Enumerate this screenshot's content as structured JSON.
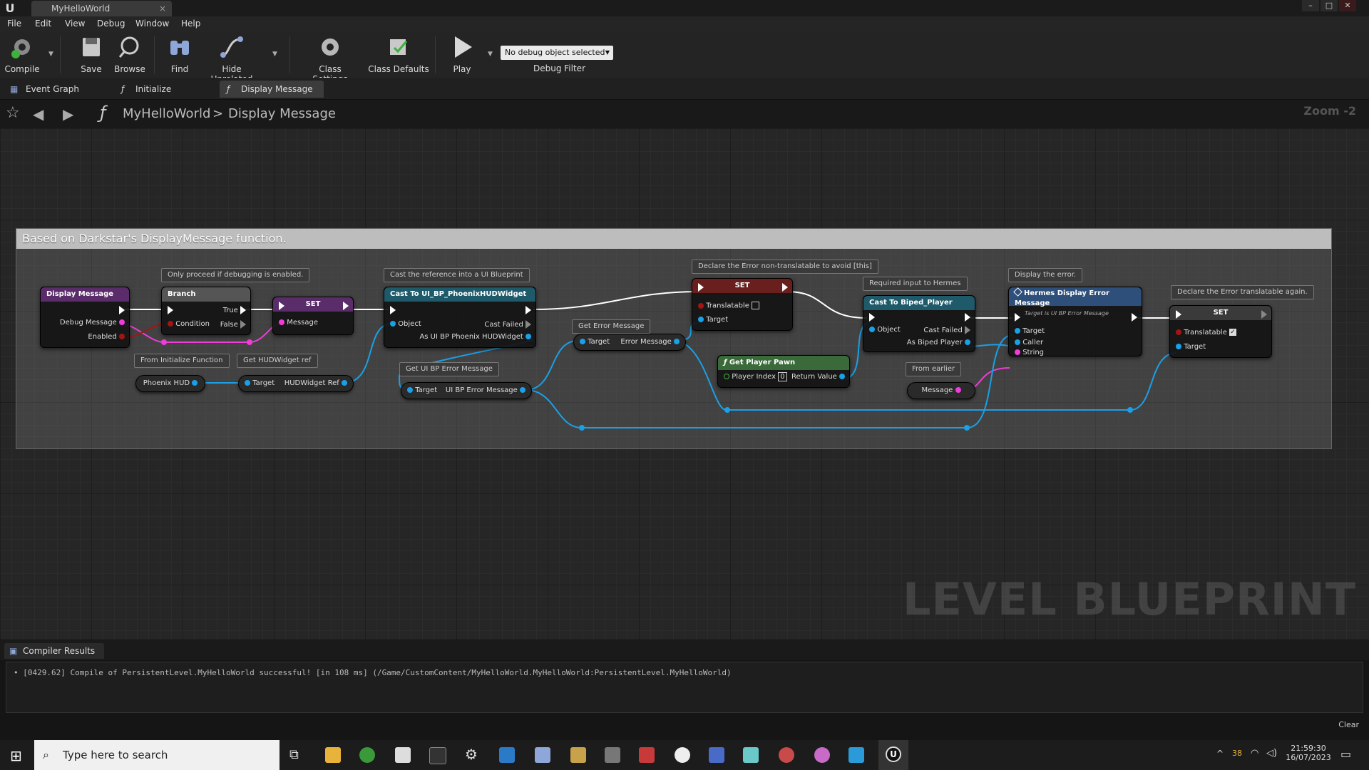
{
  "window": {
    "tab_title": "MyHelloWorld",
    "tab_close": "×"
  },
  "menu": [
    "File",
    "Edit",
    "View",
    "Debug",
    "Window",
    "Help"
  ],
  "toolbar": {
    "compile": "Compile",
    "save": "Save",
    "browse": "Browse",
    "find": "Find",
    "hide_unrelated": "Hide Unrelated",
    "class_settings": "Class Settings",
    "class_defaults": "Class Defaults",
    "play": "Play",
    "debug_select": "No debug object selected",
    "debug_filter": "Debug Filter"
  },
  "doc_tabs": [
    "Event Graph",
    "Initialize",
    "Display Message"
  ],
  "breadcrumb": {
    "root": "MyHelloWorld",
    "sep": ">",
    "current": "Display Message",
    "zoom": "Zoom -2"
  },
  "comment_title": "Based on Darkstar's DisplayMessage function.",
  "bubbles": {
    "b1": "Only proceed if debugging is enabled.",
    "b2": "Cast the reference into a UI Blueprint",
    "b3": "Declare the Error non-translatable to avoid [this]",
    "b4": "Required input to Hermes",
    "b5": "Display the error.",
    "b6": "Declare the Error translatable again.",
    "b7": "From Initialize Function",
    "b8": "Get HUDWidget ref",
    "b9": "Get Error Message",
    "b10": "Get UI BP Error Message",
    "b11": "From earlier"
  },
  "nodes": {
    "display_message": {
      "title": "Display Message",
      "pin1": "Debug Message",
      "pin2": "Enabled"
    },
    "branch": {
      "title": "Branch",
      "true": "True",
      "false": "False",
      "condition": "Condition"
    },
    "set1": {
      "title": "SET",
      "pin": "Message"
    },
    "cast_hud": {
      "title": "Cast To UI_BP_PhoenixHUDWidget",
      "object": "Object",
      "failed": "Cast Failed",
      "as": "As UI BP Phoenix HUDWidget"
    },
    "phoenix_hud": {
      "label": "Phoenix HUD"
    },
    "get_hud_ref": {
      "target": "Target",
      "out": "HUDWidget Ref"
    },
    "get_err_msg": {
      "target": "Target",
      "out": "Error Message"
    },
    "get_ui_err": {
      "target": "Target",
      "out": "UI BP Error Message"
    },
    "set2": {
      "title": "SET",
      "translatable": "Translatable",
      "target": "Target"
    },
    "get_pawn": {
      "title": "Get Player Pawn",
      "index": "Player Index",
      "index_val": "0",
      "ret": "Return Value"
    },
    "cast_biped": {
      "title": "Cast To Biped_Player",
      "object": "Object",
      "failed": "Cast Failed",
      "as": "As Biped Player"
    },
    "message_var": {
      "label": "Message"
    },
    "hermes": {
      "title": "Hermes Display Error Message",
      "subtitle": "Target is UI BP Error Message",
      "target": "Target",
      "caller": "Caller",
      "string": "String"
    },
    "set3": {
      "title": "SET",
      "translatable": "Translatable",
      "target": "Target"
    }
  },
  "watermark": "LEVEL BLUEPRINT",
  "compiler": {
    "tab": "Compiler Results",
    "line": "[0429.62] Compile of PersistentLevel.MyHelloWorld successful! [in 108 ms] (/Game/CustomContent/MyHelloWorld.MyHelloWorld:PersistentLevel.MyHelloWorld)",
    "clear": "Clear"
  },
  "taskbar": {
    "search_placeholder": "Type here to search",
    "time": "21:59:30",
    "date": "16/07/2023",
    "temp": "38"
  },
  "colors": {
    "exec": "#ffffff",
    "object": "#1aa0e6",
    "string": "#f03cd8",
    "bool": "#a31515",
    "func_hdr": "#2d5f8a",
    "pure_hdr": "#3a7a3a"
  }
}
